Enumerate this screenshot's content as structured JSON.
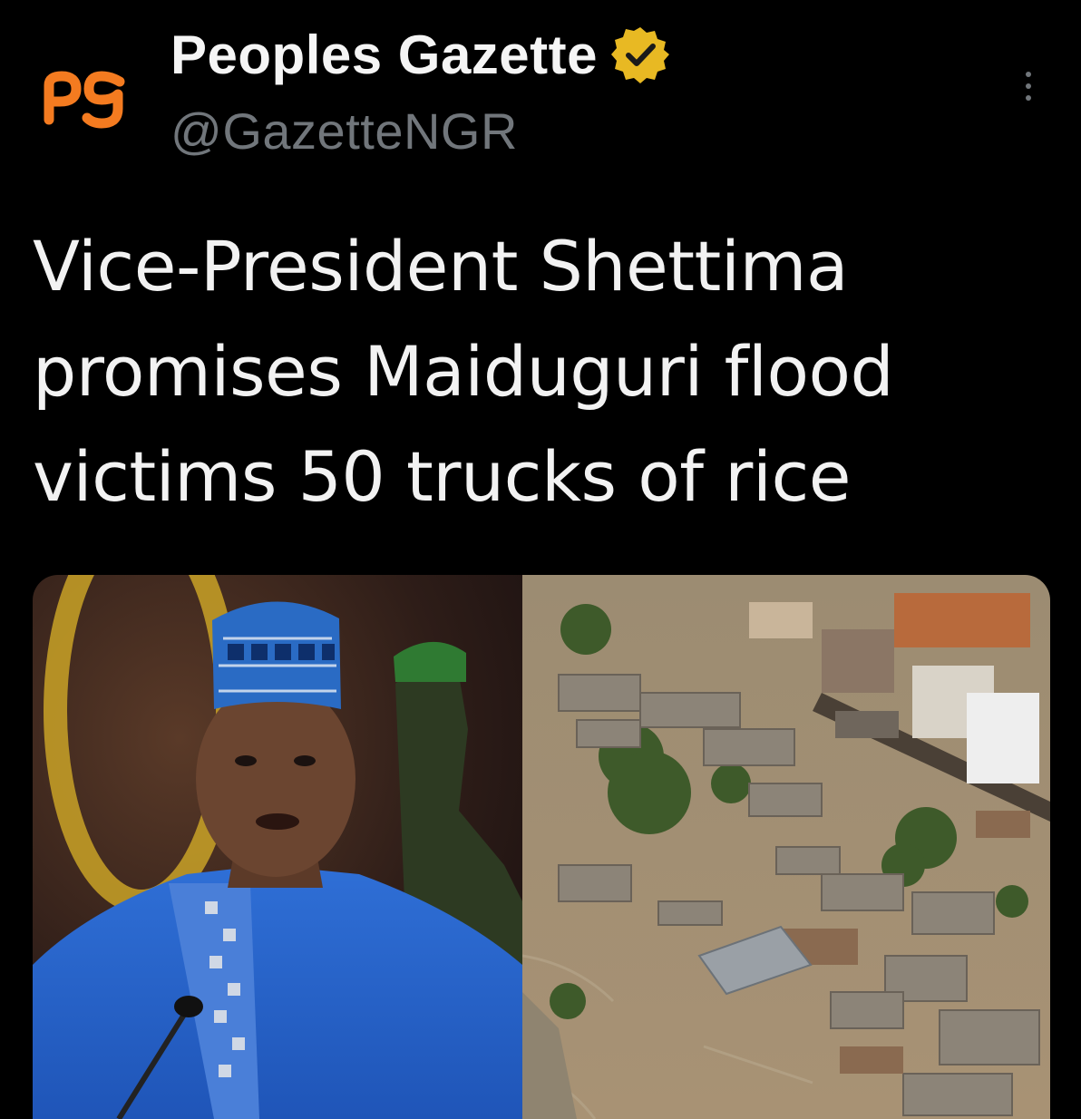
{
  "account": {
    "display_name": "Peoples Gazette",
    "handle": "@GazetteNGR",
    "avatar_text": "pg",
    "verified": true
  },
  "tweet": {
    "text": "Vice-President Shettima\npromises Maiduguri flood\nvictims 50 trucks of rice"
  },
  "colors": {
    "background": "#000000",
    "brand_orange": "#f47b20",
    "verified_gold": "#e8b923",
    "muted_text": "#71767b"
  },
  "icons": {
    "verified": "verified-badge-icon",
    "more": "more-options-icon"
  },
  "media": {
    "count": 2
  }
}
